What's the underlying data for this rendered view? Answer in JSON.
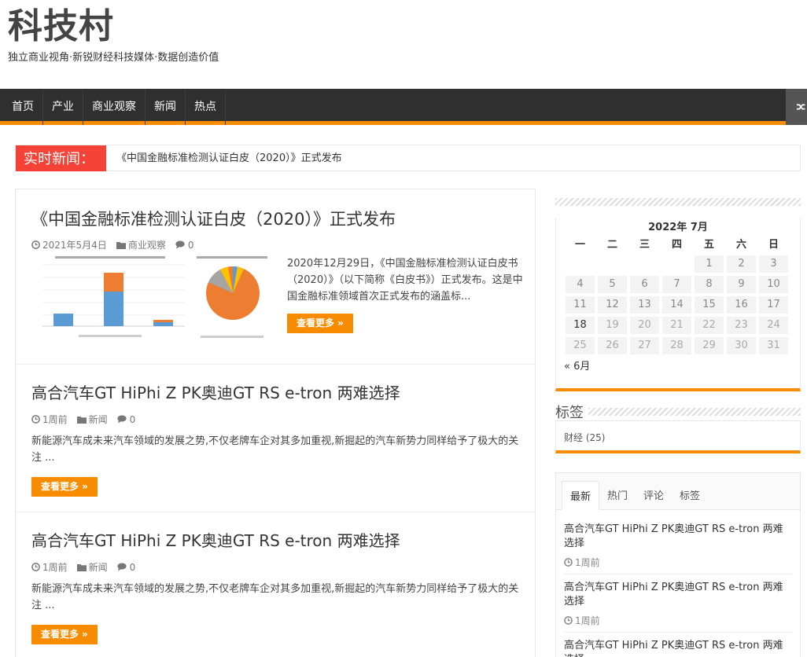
{
  "site": {
    "title": "科技村",
    "tagline": "独立商业视角·新锐财经科技媒体·数据创造价值"
  },
  "nav": {
    "items": [
      "首页",
      "产业",
      "商业观察",
      "新闻",
      "热点"
    ]
  },
  "breaking": {
    "label": "实时新闻：",
    "text": "《中国金融标准检测认证白皮（2020）》正式发布"
  },
  "posts": [
    {
      "title": "《中国金融标准检测认证白皮（2020）》正式发布",
      "date": "2021年5月4日",
      "category": "商业观察",
      "comments": "0",
      "excerpt": "2020年12月29日，《中国金融标准检测认证白皮书（2020）》（以下简称《白皮书》）正式发布。这是中国金融标准领域首次正式发布的涵盖标...",
      "more": "查看更多 »"
    },
    {
      "title": "高合汽车GT HiPhi Z PK奥迪GT RS e-tron 两难选择",
      "date": "1周前",
      "category": "新闻",
      "comments": "0",
      "excerpt": "新能源汽车成未来汽车领域的发展之势,不仅老牌车企对其多加重视,新掘起的汽车新势力同样给予了极大的关注 ...",
      "more": "查看更多 »"
    },
    {
      "title": "高合汽车GT HiPhi Z PK奥迪GT RS e-tron 两难选择",
      "date": "1周前",
      "category": "新闻",
      "comments": "0",
      "excerpt": "新能源汽车成未来汽车领域的发展之势,不仅老牌车企对其多加重视,新掘起的汽车新势力同样给予了极大的关注 ...",
      "more": "查看更多 »"
    }
  ],
  "calendar": {
    "caption": "2022年 7月",
    "weekdays": [
      "一",
      "二",
      "三",
      "四",
      "五",
      "六",
      "日"
    ],
    "leading_blanks": 4,
    "days": 31,
    "today": 18,
    "prev": "« 6月"
  },
  "tags": {
    "title": "标签",
    "items": [
      "财经 (25)"
    ]
  },
  "tabs": {
    "labels": [
      "最新",
      "热门",
      "评论",
      "标签"
    ],
    "active": 0,
    "items": [
      {
        "title": "高合汽车GT HiPhi Z PK奥迪GT RS e-tron 两难选择",
        "time": "1周前"
      },
      {
        "title": "高合汽车GT HiPhi Z PK奥迪GT RS e-tron 两难选择",
        "time": "1周前"
      },
      {
        "title": "高合汽车GT HiPhi Z PK奥迪GT RS e-tron 两难选择",
        "time": ""
      }
    ]
  },
  "colors": {
    "accent": "#f88c00",
    "breaking": "#f44236",
    "nav": "#2f2f2f"
  }
}
